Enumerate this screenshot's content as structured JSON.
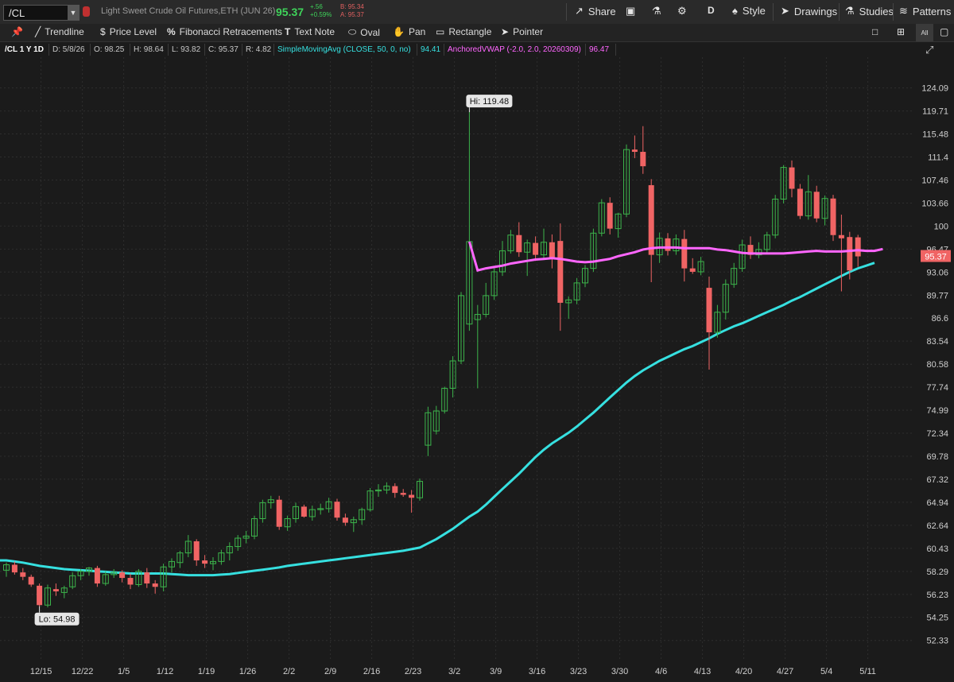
{
  "header": {
    "symbol": "/CL",
    "description": "Light Sweet Crude Oil Futures,ETH (JUN 26)",
    "last": "95.37",
    "change": "+.56",
    "change_pct": "+0.59%",
    "bid": "B: 95.34",
    "ask": "A: 95.37"
  },
  "toolbar": {
    "share": "Share",
    "period": "D",
    "style": "Style",
    "drawings": "Drawings",
    "studies": "Studies",
    "patterns": "Patterns"
  },
  "drawing_tools": {
    "trendline": "Trendline",
    "price_level": "Price Level",
    "fibonacci": "Fibonacci Retracements",
    "text_note": "Text Note",
    "oval": "Oval",
    "pan": "Pan",
    "rectangle": "Rectangle",
    "pointer": "Pointer",
    "all_label": "All"
  },
  "info": {
    "title": "/CL 1 Y 1D",
    "date": "D: 5/8/26",
    "open": "O: 98.25",
    "high": "H: 98.64",
    "low": "L: 93.82",
    "close": "C: 95.37",
    "range": "R: 4.82",
    "sma_label": "SimpleMovingAvg (CLOSE, 50, 0, no)",
    "sma_value": "94.41",
    "vwap_label": "AnchoredVWAP (-2.0, 2.0, 20260309)",
    "vwap_value": "96.47"
  },
  "colors": {
    "up": "#3cb44b",
    "down": "#f06464",
    "sma": "#36e0e0",
    "vwap": "#ff66ff",
    "background": "#1b1b1b",
    "grid": "#2e2e2e"
  },
  "chart_data": {
    "type": "candlestick",
    "price_axis_ticks": [
      "124.09",
      "119.71",
      "115.48",
      "111.4",
      "107.46",
      "103.66",
      "100",
      "96.47",
      "93.06",
      "89.77",
      "86.6",
      "83.54",
      "80.58",
      "77.74",
      "74.99",
      "72.34",
      "69.78",
      "67.32",
      "64.94",
      "62.64",
      "60.43",
      "58.29",
      "56.23",
      "54.25",
      "52.33"
    ],
    "x_axis_labels": [
      "12/15",
      "12/22",
      "1/5",
      "1/12",
      "1/19",
      "1/26",
      "2/2",
      "2/9",
      "2/16",
      "2/23",
      "3/2",
      "3/9",
      "3/16",
      "3/23",
      "3/30",
      "4/6",
      "4/13",
      "4/20",
      "4/27",
      "5/4",
      "5/11"
    ],
    "ylim": [
      51.6,
      127.0
    ],
    "high_label": "Hi: 119.48",
    "low_label": "Lo: 54.98",
    "last_price_tag": "95.37",
    "candles": [
      {
        "o": 58.4,
        "h": 59.1,
        "l": 57.8,
        "c": 58.9
      },
      {
        "o": 58.9,
        "h": 59.2,
        "l": 58.0,
        "c": 58.2
      },
      {
        "o": 58.2,
        "h": 58.6,
        "l": 57.5,
        "c": 57.8
      },
      {
        "o": 57.8,
        "h": 58.0,
        "l": 56.9,
        "c": 57.1
      },
      {
        "o": 57.0,
        "h": 57.2,
        "l": 55.2,
        "c": 55.3
      },
      {
        "o": 55.3,
        "h": 57.1,
        "l": 55.1,
        "c": 56.8
      },
      {
        "o": 56.7,
        "h": 57.2,
        "l": 56.1,
        "c": 56.5
      },
      {
        "o": 56.4,
        "h": 57.0,
        "l": 55.9,
        "c": 56.8
      },
      {
        "o": 56.9,
        "h": 58.2,
        "l": 56.7,
        "c": 57.9
      },
      {
        "o": 57.9,
        "h": 58.5,
        "l": 57.5,
        "c": 58.3
      },
      {
        "o": 58.3,
        "h": 58.7,
        "l": 57.9,
        "c": 58.6
      },
      {
        "o": 58.6,
        "h": 58.8,
        "l": 56.9,
        "c": 57.2
      },
      {
        "o": 57.2,
        "h": 58.3,
        "l": 57.0,
        "c": 58.0
      },
      {
        "o": 58.0,
        "h": 58.5,
        "l": 57.7,
        "c": 58.2
      },
      {
        "o": 58.2,
        "h": 58.4,
        "l": 57.3,
        "c": 57.7
      },
      {
        "o": 57.7,
        "h": 58.1,
        "l": 56.7,
        "c": 57.1
      },
      {
        "o": 57.1,
        "h": 58.5,
        "l": 56.9,
        "c": 58.3
      },
      {
        "o": 58.2,
        "h": 58.6,
        "l": 56.8,
        "c": 57.2
      },
      {
        "o": 57.2,
        "h": 57.5,
        "l": 56.3,
        "c": 56.9
      },
      {
        "o": 56.9,
        "h": 59.0,
        "l": 56.5,
        "c": 58.7
      },
      {
        "o": 58.7,
        "h": 59.5,
        "l": 58.2,
        "c": 59.2
      },
      {
        "o": 59.1,
        "h": 60.2,
        "l": 58.6,
        "c": 60.0
      },
      {
        "o": 60.0,
        "h": 61.7,
        "l": 59.6,
        "c": 61.1
      },
      {
        "o": 61.1,
        "h": 61.3,
        "l": 58.8,
        "c": 59.3
      },
      {
        "o": 59.3,
        "h": 59.8,
        "l": 58.6,
        "c": 59.0
      },
      {
        "o": 59.0,
        "h": 59.6,
        "l": 58.4,
        "c": 59.2
      },
      {
        "o": 59.2,
        "h": 60.3,
        "l": 58.9,
        "c": 60.0
      },
      {
        "o": 60.0,
        "h": 61.0,
        "l": 59.3,
        "c": 60.6
      },
      {
        "o": 60.6,
        "h": 61.7,
        "l": 60.2,
        "c": 61.4
      },
      {
        "o": 61.4,
        "h": 62.1,
        "l": 60.9,
        "c": 61.6
      },
      {
        "o": 61.6,
        "h": 63.6,
        "l": 61.3,
        "c": 63.3
      },
      {
        "o": 63.3,
        "h": 65.2,
        "l": 62.9,
        "c": 64.9
      },
      {
        "o": 64.9,
        "h": 65.6,
        "l": 64.3,
        "c": 65.2
      },
      {
        "o": 65.2,
        "h": 65.6,
        "l": 62.2,
        "c": 62.5
      },
      {
        "o": 62.5,
        "h": 63.6,
        "l": 62.1,
        "c": 63.3
      },
      {
        "o": 63.3,
        "h": 64.9,
        "l": 62.9,
        "c": 64.5
      },
      {
        "o": 64.5,
        "h": 64.7,
        "l": 63.4,
        "c": 63.5
      },
      {
        "o": 63.5,
        "h": 64.6,
        "l": 63.1,
        "c": 64.2
      },
      {
        "o": 64.2,
        "h": 64.8,
        "l": 63.7,
        "c": 64.3
      },
      {
        "o": 64.3,
        "h": 65.4,
        "l": 63.9,
        "c": 65.0
      },
      {
        "o": 65.0,
        "h": 65.3,
        "l": 63.1,
        "c": 63.4
      },
      {
        "o": 63.4,
        "h": 63.8,
        "l": 62.6,
        "c": 62.9
      },
      {
        "o": 62.9,
        "h": 63.5,
        "l": 62.0,
        "c": 63.2
      },
      {
        "o": 63.2,
        "h": 64.4,
        "l": 62.7,
        "c": 64.2
      },
      {
        "o": 64.2,
        "h": 66.4,
        "l": 64.0,
        "c": 66.1
      },
      {
        "o": 66.1,
        "h": 66.8,
        "l": 65.5,
        "c": 66.2
      },
      {
        "o": 66.2,
        "h": 67.0,
        "l": 65.8,
        "c": 66.6
      },
      {
        "o": 66.6,
        "h": 66.9,
        "l": 65.4,
        "c": 65.9
      },
      {
        "o": 65.9,
        "h": 66.3,
        "l": 65.5,
        "c": 65.7
      },
      {
        "o": 65.7,
        "h": 66.2,
        "l": 63.9,
        "c": 65.4
      },
      {
        "o": 65.4,
        "h": 67.4,
        "l": 65.1,
        "c": 67.1
      },
      {
        "o": 71.0,
        "h": 75.4,
        "l": 69.8,
        "c": 74.7
      },
      {
        "o": 72.6,
        "h": 75.5,
        "l": 72.2,
        "c": 74.9
      },
      {
        "o": 74.9,
        "h": 77.8,
        "l": 74.6,
        "c": 77.6
      },
      {
        "o": 77.6,
        "h": 81.6,
        "l": 76.5,
        "c": 81.0
      },
      {
        "o": 81.0,
        "h": 90.2,
        "l": 80.6,
        "c": 89.7
      },
      {
        "o": 85.8,
        "h": 119.48,
        "l": 84.9,
        "c": 97.6
      },
      {
        "o": 86.4,
        "h": 88.4,
        "l": 77.6,
        "c": 87.1
      },
      {
        "o": 87.1,
        "h": 91.5,
        "l": 86.7,
        "c": 89.7
      },
      {
        "o": 89.7,
        "h": 93.8,
        "l": 89.1,
        "c": 93.1
      },
      {
        "o": 93.1,
        "h": 97.7,
        "l": 92.5,
        "c": 96.2
      },
      {
        "o": 96.2,
        "h": 99.4,
        "l": 95.8,
        "c": 98.6
      },
      {
        "o": 98.6,
        "h": 100.6,
        "l": 95.3,
        "c": 96.0
      },
      {
        "o": 96.0,
        "h": 97.9,
        "l": 92.5,
        "c": 97.4
      },
      {
        "o": 97.4,
        "h": 98.4,
        "l": 94.7,
        "c": 95.6
      },
      {
        "o": 95.6,
        "h": 99.6,
        "l": 95.0,
        "c": 97.5
      },
      {
        "o": 97.5,
        "h": 98.7,
        "l": 93.6,
        "c": 95.1
      },
      {
        "o": 97.7,
        "h": 100.4,
        "l": 84.9,
        "c": 88.7
      },
      {
        "o": 88.7,
        "h": 89.6,
        "l": 86.5,
        "c": 89.1
      },
      {
        "o": 89.1,
        "h": 92.2,
        "l": 88.5,
        "c": 91.5
      },
      {
        "o": 91.5,
        "h": 94.1,
        "l": 90.9,
        "c": 93.6
      },
      {
        "o": 93.6,
        "h": 99.6,
        "l": 93.1,
        "c": 98.9
      },
      {
        "o": 98.9,
        "h": 104.3,
        "l": 98.4,
        "c": 103.7
      },
      {
        "o": 103.7,
        "h": 104.6,
        "l": 98.7,
        "c": 99.6
      },
      {
        "o": 99.6,
        "h": 102.1,
        "l": 98.2,
        "c": 101.9
      },
      {
        "o": 101.9,
        "h": 113.6,
        "l": 101.4,
        "c": 112.7
      },
      {
        "o": 112.7,
        "h": 115.2,
        "l": 111.2,
        "c": 112.3
      },
      {
        "o": 112.3,
        "h": 116.9,
        "l": 108.5,
        "c": 109.8
      },
      {
        "o": 106.6,
        "h": 107.6,
        "l": 91.6,
        "c": 95.6
      },
      {
        "o": 95.6,
        "h": 99.0,
        "l": 94.4,
        "c": 98.1
      },
      {
        "o": 98.1,
        "h": 98.9,
        "l": 95.5,
        "c": 96.2
      },
      {
        "o": 96.2,
        "h": 98.7,
        "l": 95.6,
        "c": 98.0
      },
      {
        "o": 98.0,
        "h": 99.4,
        "l": 91.7,
        "c": 93.6
      },
      {
        "o": 93.6,
        "h": 95.1,
        "l": 92.8,
        "c": 93.1
      },
      {
        "o": 93.1,
        "h": 95.3,
        "l": 92.6,
        "c": 94.6
      },
      {
        "o": 90.8,
        "h": 92.4,
        "l": 79.9,
        "c": 84.7
      },
      {
        "o": 84.7,
        "h": 88.4,
        "l": 84.0,
        "c": 87.4
      },
      {
        "o": 87.4,
        "h": 92.0,
        "l": 86.4,
        "c": 91.3
      },
      {
        "o": 91.3,
        "h": 94.4,
        "l": 90.8,
        "c": 93.6
      },
      {
        "o": 93.6,
        "h": 97.9,
        "l": 93.1,
        "c": 97.1
      },
      {
        "o": 97.1,
        "h": 98.4,
        "l": 95.0,
        "c": 95.6
      },
      {
        "o": 95.6,
        "h": 97.5,
        "l": 95.1,
        "c": 96.4
      },
      {
        "o": 96.4,
        "h": 99.1,
        "l": 95.8,
        "c": 98.6
      },
      {
        "o": 98.6,
        "h": 105.0,
        "l": 98.1,
        "c": 104.3
      },
      {
        "o": 104.3,
        "h": 110.0,
        "l": 103.6,
        "c": 109.6
      },
      {
        "o": 109.6,
        "h": 110.8,
        "l": 104.6,
        "c": 106.0
      },
      {
        "o": 106.0,
        "h": 106.8,
        "l": 101.1,
        "c": 101.6
      },
      {
        "o": 101.6,
        "h": 108.3,
        "l": 101.0,
        "c": 105.5
      },
      {
        "o": 105.5,
        "h": 106.5,
        "l": 100.6,
        "c": 101.2
      },
      {
        "o": 101.2,
        "h": 104.9,
        "l": 100.1,
        "c": 104.4
      },
      {
        "o": 104.4,
        "h": 105.0,
        "l": 97.7,
        "c": 98.6
      },
      {
        "o": 98.6,
        "h": 101.8,
        "l": 90.3,
        "c": 98.1
      },
      {
        "o": 98.3,
        "h": 99.1,
        "l": 92.0,
        "c": 93.3
      },
      {
        "o": 98.25,
        "h": 98.64,
        "l": 93.82,
        "c": 95.37
      }
    ],
    "sma": [
      59.3,
      59.2,
      59.1,
      58.95,
      58.8,
      58.7,
      58.6,
      58.5,
      58.45,
      58.4,
      58.35,
      58.3,
      58.25,
      58.2,
      58.15,
      58.1,
      58.1,
      58.1,
      58.1,
      58.1,
      58.05,
      58.0,
      57.95,
      57.95,
      57.95,
      57.95,
      58.0,
      58.05,
      58.15,
      58.25,
      58.35,
      58.45,
      58.55,
      58.65,
      58.8,
      58.9,
      59.0,
      59.1,
      59.2,
      59.3,
      59.4,
      59.5,
      59.6,
      59.7,
      59.8,
      59.9,
      60.0,
      60.1,
      60.2,
      60.35,
      60.5,
      60.9,
      61.3,
      61.8,
      62.3,
      62.9,
      63.5,
      64.0,
      64.7,
      65.5,
      66.3,
      67.1,
      67.9,
      68.8,
      69.7,
      70.5,
      71.2,
      71.8,
      72.4,
      73.1,
      73.9,
      74.7,
      75.6,
      76.5,
      77.4,
      78.3,
      79.1,
      79.8,
      80.4,
      81.0,
      81.5,
      82.0,
      82.5,
      82.9,
      83.4,
      83.9,
      84.5,
      85.0,
      85.5,
      85.9,
      86.4,
      86.9,
      87.4,
      87.9,
      88.4,
      89.0,
      89.5,
      90.1,
      90.7,
      91.3,
      91.9,
      92.5,
      93.1,
      93.6,
      94.0,
      94.41
    ],
    "vwap": [
      97.6,
      93.3,
      93.6,
      93.8,
      94.0,
      94.3,
      94.5,
      94.7,
      94.9,
      95.0,
      95.1,
      95.0,
      94.8,
      94.6,
      94.5,
      94.6,
      94.8,
      95.0,
      95.4,
      95.7,
      96.0,
      96.4,
      96.6,
      96.7,
      96.7,
      96.7,
      96.6,
      96.6,
      96.6,
      96.6,
      96.4,
      96.3,
      96.1,
      95.9,
      95.8,
      95.8,
      95.8,
      95.8,
      95.8,
      95.9,
      96.0,
      96.1,
      96.2,
      96.1,
      96.1,
      96.1,
      96.2,
      96.3,
      96.2,
      96.2,
      96.47
    ]
  }
}
